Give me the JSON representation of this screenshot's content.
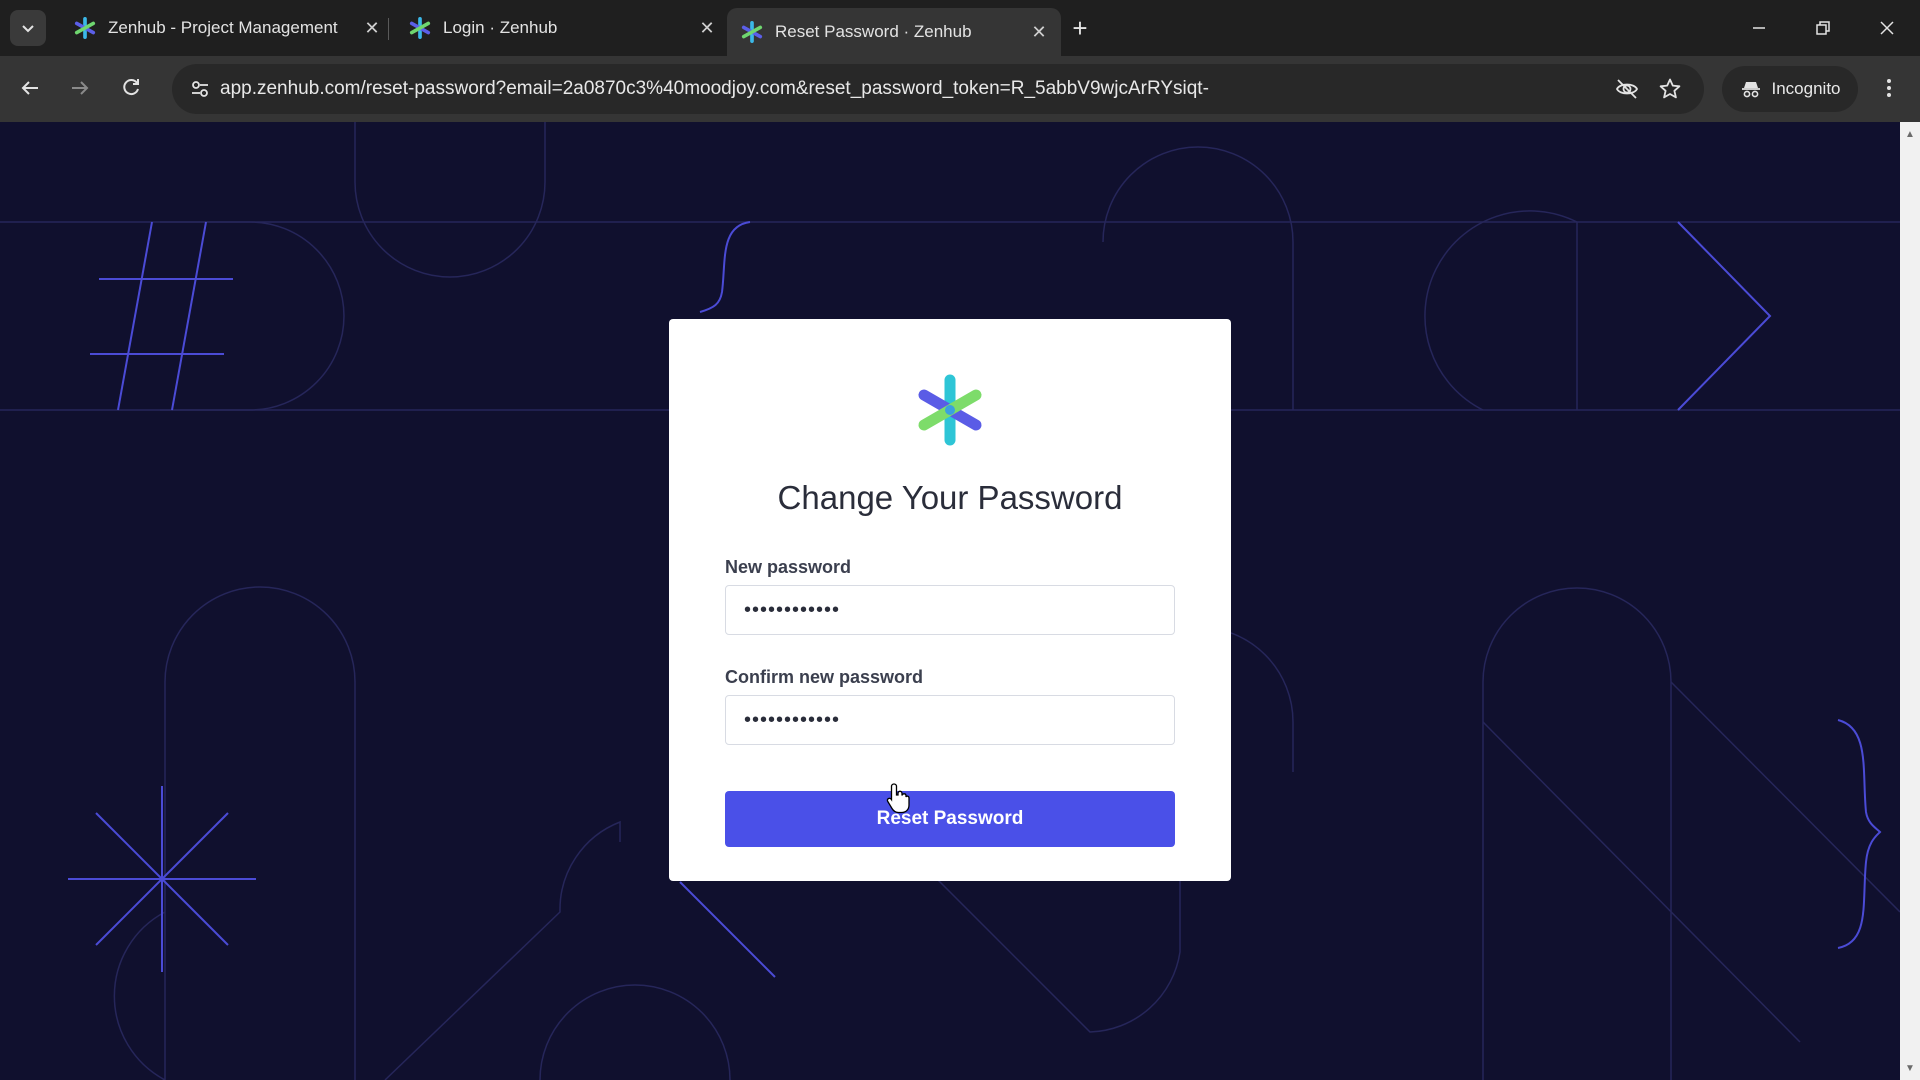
{
  "browser": {
    "tabs": [
      {
        "title": "Zenhub - Project Management",
        "active": false
      },
      {
        "title": "Login · Zenhub",
        "active": false
      },
      {
        "title": "Reset Password · Zenhub",
        "active": true
      }
    ],
    "url": "app.zenhub.com/reset-password?email=2a0870c3%40moodjoy.com&reset_password_token=R_5abbV9wjcArRYsiqt-",
    "incognito_label": "Incognito"
  },
  "page": {
    "title": "Change Your Password",
    "new_password": {
      "label": "New password",
      "value": "••••••••••••"
    },
    "confirm_password": {
      "label": "Confirm new password",
      "value": "••••••••••••"
    },
    "submit_label": "Reset Password",
    "colors": {
      "background": "#10102e",
      "button": "#4a50e8",
      "line_accent": "#4b4bd6"
    }
  }
}
